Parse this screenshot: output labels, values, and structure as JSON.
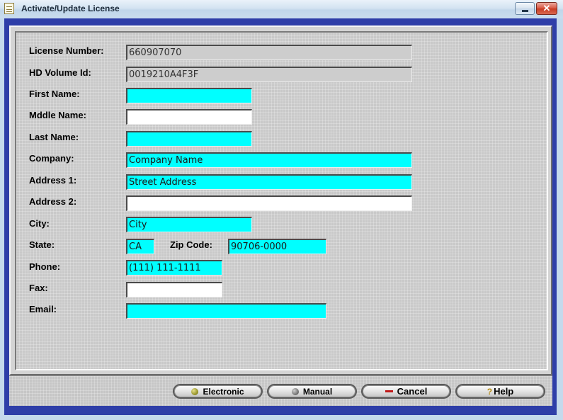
{
  "window": {
    "title": "Activate/Update License",
    "close_glyph": "✕"
  },
  "form": {
    "license_number": {
      "label": "License Number:",
      "value": "660907070"
    },
    "hd_volume_id": {
      "label": "HD Volume Id:",
      "value": "0019210A4F3F"
    },
    "first_name": {
      "label": "First Name:",
      "value": ""
    },
    "middle_name": {
      "label": "Mddle Name:",
      "value": ""
    },
    "last_name": {
      "label": "Last Name:",
      "value": ""
    },
    "company": {
      "label": "Company:",
      "value": "Company Name"
    },
    "address1": {
      "label": "Address 1:",
      "value": "Street Address"
    },
    "address2": {
      "label": "Address 2:",
      "value": ""
    },
    "city": {
      "label": "City:",
      "value": "City"
    },
    "state": {
      "label": "State:",
      "value": "CA"
    },
    "zip": {
      "label": "Zip Code:",
      "value": "90706-0000"
    },
    "phone": {
      "label": "Phone:",
      "value": "(111) 111-1111"
    },
    "fax": {
      "label": "Fax:",
      "value": ""
    },
    "email": {
      "label": "Email:",
      "value": ""
    }
  },
  "buttons": {
    "electronic": {
      "label": "Electronic",
      "icon": "olive-ball-icon"
    },
    "manual": {
      "label": "Manual",
      "icon": "gray-ball-icon"
    },
    "cancel": {
      "label": "Cancel",
      "icon": "minus-icon"
    },
    "help": {
      "label": "Help",
      "icon": "question-icon",
      "glyph": "?"
    }
  },
  "colors": {
    "required_field": "#00ffff",
    "optional_field": "#ffffff",
    "readonly_field": "#cdcdcd",
    "client_border": "#2e3ea8"
  }
}
